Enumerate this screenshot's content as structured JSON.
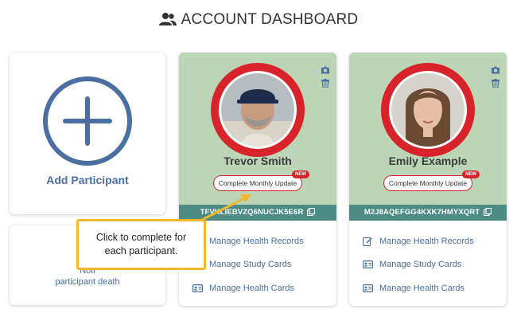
{
  "header": {
    "title": "ACCOUNT DASHBOARD",
    "icon": "people-icon"
  },
  "add_card": {
    "label": "Add Participant",
    "icon": "plus-circle-icon"
  },
  "notify_card": {
    "line1": "Noti",
    "line2": "participant death"
  },
  "callout": {
    "line1": "Click to complete for",
    "line2": "each participant."
  },
  "colors": {
    "accent_red": "#d9232a",
    "card_green": "#bcd5b6",
    "teal": "#4c8c85",
    "link_blue": "#4a6fa0",
    "callout_yellow": "#f3b62c"
  },
  "participants": [
    {
      "name": "Trevor Smith",
      "update_label": "Complete Monthly Update",
      "badge": "NEW",
      "code": "TFVKLIEBVZQ6NUCJK5E6R",
      "menu": [
        {
          "label": "Manage Health Records",
          "icon": "edit-icon"
        },
        {
          "label": "Manage Study Cards",
          "icon": "id-card-icon"
        },
        {
          "label": "Manage Health Cards",
          "icon": "id-card-icon"
        }
      ]
    },
    {
      "name": "Emily Example",
      "update_label": "Complete Monthly Update",
      "badge": "NEW",
      "code": "M2J8AQEFGG4KXK7HMYXQRT",
      "menu": [
        {
          "label": "Manage Health Records",
          "icon": "edit-icon"
        },
        {
          "label": "Manage Study Cards",
          "icon": "id-card-icon"
        },
        {
          "label": "Manage Health Cards",
          "icon": "id-card-icon"
        }
      ]
    }
  ]
}
